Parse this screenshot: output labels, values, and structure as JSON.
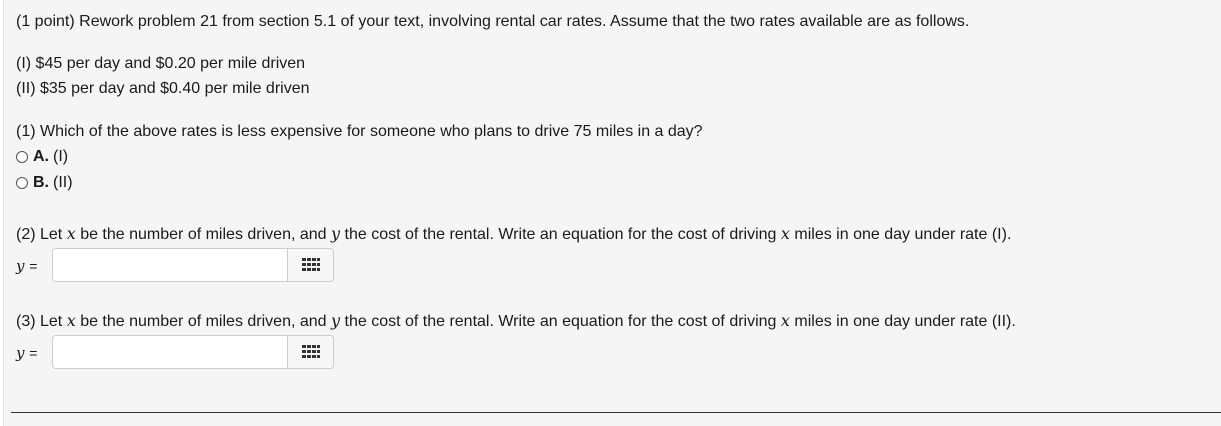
{
  "intro": "(1 point) Rework problem 21 from section 5.1 of your text, involving rental car rates. Assume that the two rates available are as follows.",
  "rates": [
    "(I) $45 per day and $0.20 per mile driven",
    "(II) $35 per day and $0.40 per mile driven"
  ],
  "q1": {
    "text": "(1) Which of the above rates is less expensive for someone who plans to drive 75 miles in a day?",
    "options": [
      {
        "letter": "A.",
        "text": "(I)"
      },
      {
        "letter": "B.",
        "text": "(II)"
      }
    ]
  },
  "q2": {
    "prefix": "(2) Let",
    "x": "x",
    "mid1": "be the number of miles driven, and",
    "y": "y",
    "mid2": "the cost of the rental. Write an equation for the cost of driving",
    "suffix": "miles in one day under rate (I).",
    "label_var": "y",
    "label_eq": "=",
    "value": ""
  },
  "q3": {
    "prefix": "(3) Let",
    "x": "x",
    "mid1": "be the number of miles driven, and",
    "y": "y",
    "mid2": "the cost of the rental. Write an equation for the cost of driving",
    "suffix": "miles in one day under rate (II).",
    "label_var": "y",
    "label_eq": "=",
    "value": ""
  },
  "icons": {
    "palette": "equation-editor-grid-icon"
  }
}
